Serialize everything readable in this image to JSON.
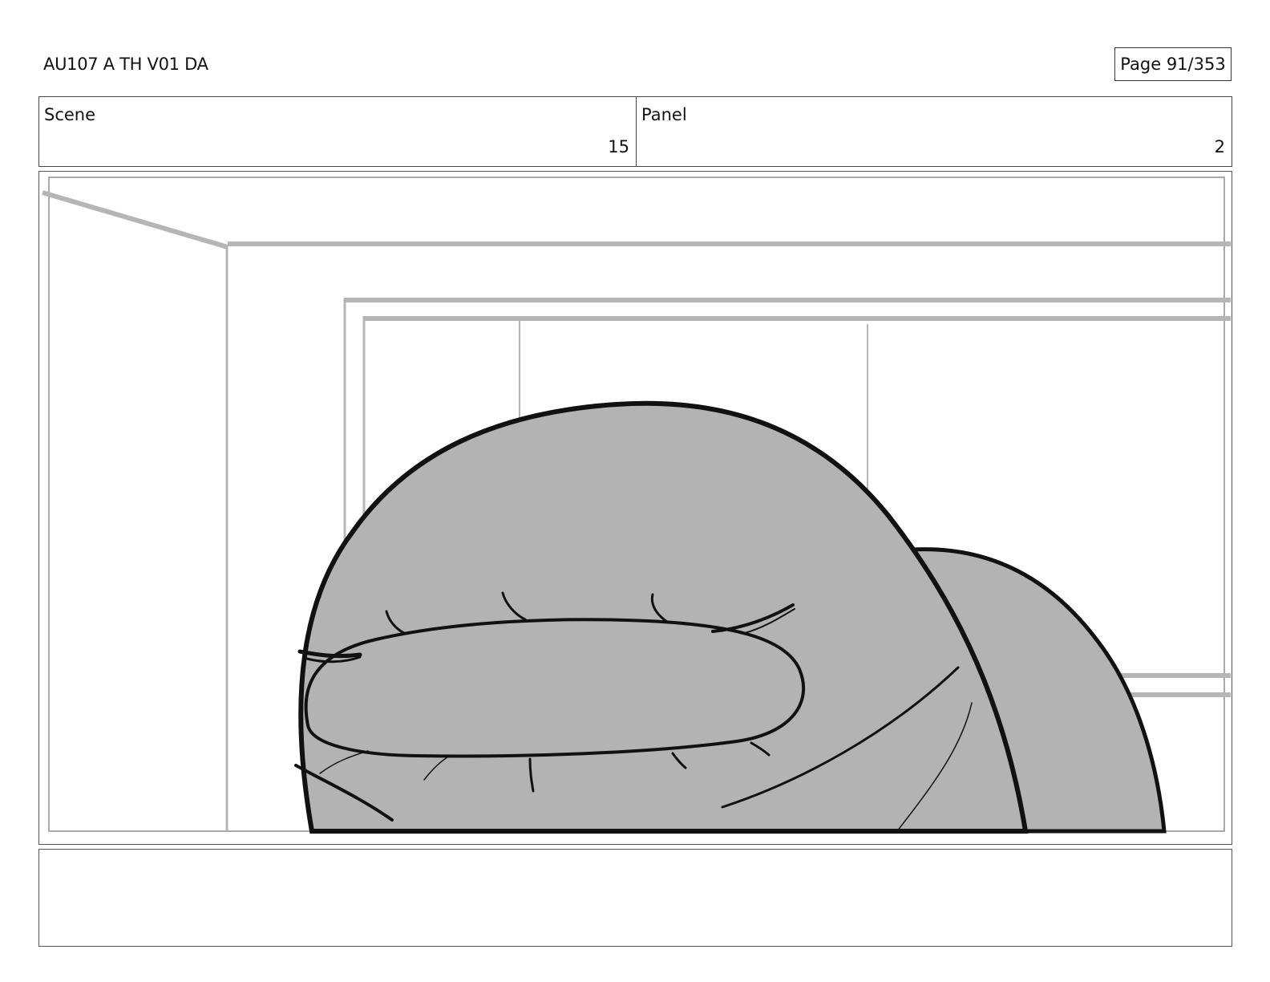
{
  "header": {
    "title": "AU107 A TH V01 DA",
    "page_label": "Page",
    "page_number": "91/353"
  },
  "info": {
    "scene_label": "Scene",
    "scene_value": "15",
    "panel_label": "Panel",
    "panel_value": "2"
  },
  "notes": {
    "text": ""
  },
  "colors": {
    "ink": "#111111",
    "character_fill": "#b3b3b3",
    "background_lines": "#b5b5b5"
  }
}
